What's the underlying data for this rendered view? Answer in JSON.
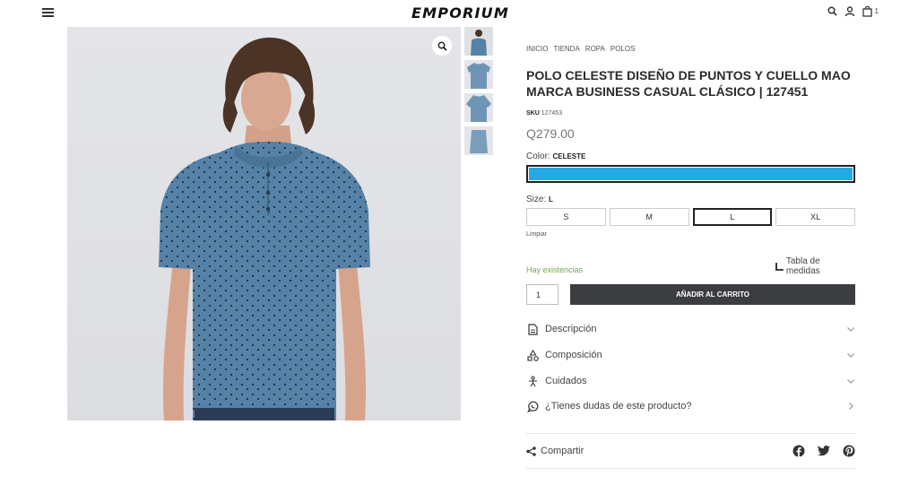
{
  "header": {
    "logo": "EMPORIUM",
    "cart_count": "1",
    "icons": [
      "menu-icon",
      "search-icon",
      "user-icon",
      "cart-icon"
    ]
  },
  "gallery": {
    "thumbnails": 4
  },
  "breadcrumb": [
    "INICIO",
    "TIENDA",
    "ROPA",
    "POLOS"
  ],
  "product": {
    "title": "POLO CELESTE DISEÑO DE PUNTOS Y CUELLO MAO MARCA BUSINESS CASUAL CLÁSICO | 127451",
    "sku_label": "SKU",
    "sku": "127453",
    "price": "Q279.00",
    "color_label": "Color:",
    "color_value": "CELESTE",
    "color_hex": "#25a9e3",
    "size_label": "Size:",
    "size_value": "L",
    "sizes": [
      "S",
      "M",
      "L",
      "XL"
    ],
    "clear_label": "Limpiar",
    "measures_label": "Tabla de medidas",
    "stock": "Hay existencias",
    "quantity": "1",
    "add_to_cart": "AÑADIR AL CARRITO"
  },
  "accordion": [
    {
      "label": "Descripción",
      "icon": "document-icon"
    },
    {
      "label": "Composición",
      "icon": "shapes-icon"
    },
    {
      "label": "Cuidados",
      "icon": "care-icon"
    },
    {
      "label": "¿Tienes dudas de este producto?",
      "icon": "whatsapp-icon"
    }
  ],
  "share": {
    "label": "Compartir",
    "networks": [
      "facebook-icon",
      "twitter-icon",
      "pinterest-icon"
    ]
  },
  "colors": {
    "accent": "#25a9e3",
    "button": "#3b3d41",
    "stock": "#6fa94e",
    "shirt": "#5582a6"
  }
}
